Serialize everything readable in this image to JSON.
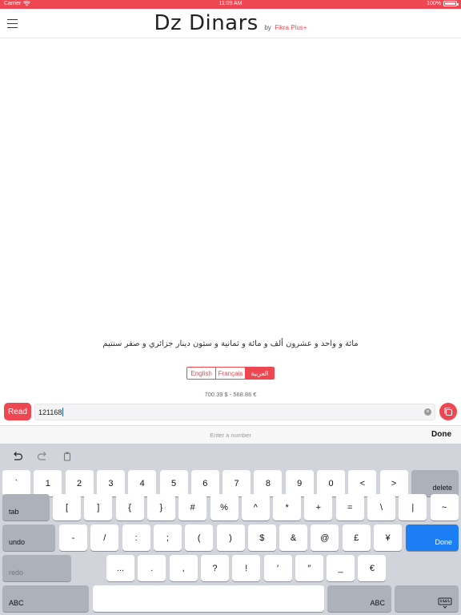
{
  "status_bar": {
    "carrier": "Carrier",
    "time": "11:09 AM",
    "battery": "100%"
  },
  "header": {
    "title": "Dz Dinars",
    "by": "by",
    "brand": "Fikra Plus+"
  },
  "result": {
    "text": "مائة و واحد و عشرون ألف و مائة و ثمانية و ستون دينار جزائري و صفر سنتيم"
  },
  "languages": [
    {
      "label": "English",
      "active": false
    },
    {
      "label": "Français",
      "active": false
    },
    {
      "label": "العربية",
      "active": true
    }
  ],
  "conversions": "700.39 $  -  568.86 €",
  "input": {
    "read_label": "Read",
    "value": "121168"
  },
  "toolbar": {
    "placeholder": "Enter a number",
    "done": "Done"
  },
  "keyboard": {
    "row1": [
      "`",
      "1",
      "2",
      "3",
      "4",
      "5",
      "6",
      "7",
      "8",
      "9",
      "0",
      "<",
      ">"
    ],
    "row1_end": "delete",
    "row2_start": "tab",
    "row2": [
      "[",
      "]",
      "{",
      "}",
      "#",
      "%",
      "^",
      "*",
      "+",
      "=",
      "\\",
      "|",
      "~"
    ],
    "row3_start": "undo",
    "row3": [
      "-",
      "/",
      ":",
      ";",
      "(",
      ")",
      "$",
      "&",
      "@",
      "£",
      "¥"
    ],
    "row3_end": "Done",
    "row4_start": "redo",
    "row4": [
      "...",
      ".",
      ",",
      "?",
      "!",
      "′",
      "″",
      "_",
      "€"
    ],
    "row5_left": "ABC",
    "row5_right": "ABC"
  },
  "colors": {
    "accent": "#ef4751",
    "keyboard_bg": "#d1d4da",
    "done_key": "#1b7ef5"
  }
}
